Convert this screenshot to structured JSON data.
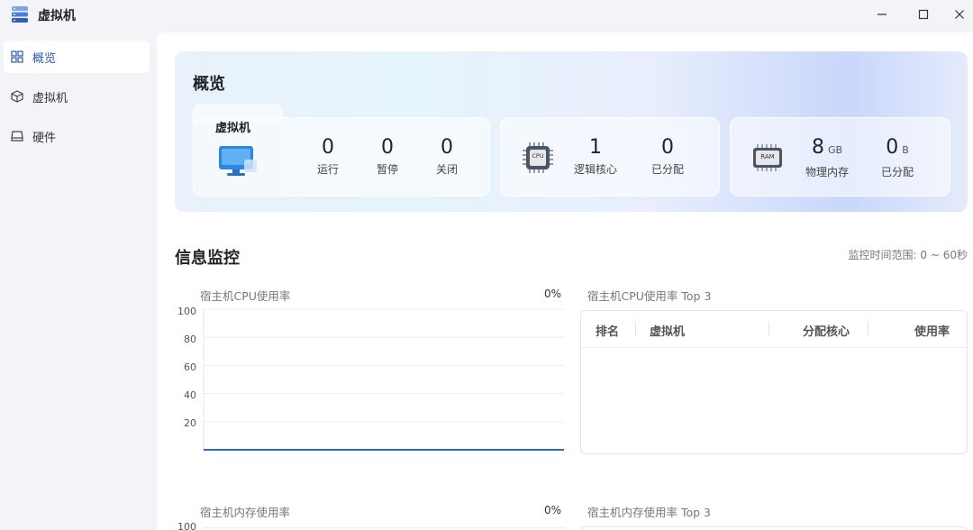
{
  "app": {
    "title": "虚拟机"
  },
  "sidebar": {
    "items": [
      {
        "label": "概览",
        "icon": "grid-icon",
        "active": true
      },
      {
        "label": "虚拟机",
        "icon": "cube-icon",
        "active": false
      },
      {
        "label": "硬件",
        "icon": "drive-icon",
        "active": false
      }
    ]
  },
  "overview": {
    "title": "概览",
    "vm_card": {
      "label": "虚拟机",
      "stats": [
        {
          "value": "0",
          "label": "运行"
        },
        {
          "value": "0",
          "label": "暂停"
        },
        {
          "value": "0",
          "label": "关闭"
        }
      ]
    },
    "cpu_card": {
      "chip_text": "CPU",
      "stats": [
        {
          "value": "1",
          "label": "逻辑核心"
        },
        {
          "value": "0",
          "label": "已分配"
        }
      ]
    },
    "ram_card": {
      "chip_text": "RAM",
      "stats": [
        {
          "value": "8",
          "unit": "GB",
          "label": "物理内存"
        },
        {
          "value": "0",
          "unit": "B",
          "label": "已分配"
        }
      ]
    }
  },
  "monitor": {
    "title": "信息监控",
    "range": "监控时间范围: 0 ~ 60秒",
    "cpu_chart": {
      "title": "宿主机CPU使用率",
      "current": "0%",
      "y_ticks": [
        "100",
        "80",
        "60",
        "40",
        "20"
      ]
    },
    "cpu_top": {
      "title": "宿主机CPU使用率 Top 3",
      "columns": [
        "排名",
        "虚拟机",
        "分配核心",
        "使用率"
      ]
    },
    "mem_chart": {
      "title": "宿主机内存使用率",
      "current": "0%",
      "y_ticks": [
        "100"
      ]
    },
    "mem_top": {
      "title": "宿主机内存使用率 Top 3"
    }
  },
  "chart_data": {
    "type": "line",
    "title": "宿主机CPU使用率",
    "ylim": [
      0,
      100
    ],
    "series": [
      {
        "values": [
          0,
          0
        ]
      }
    ],
    "grid": true
  },
  "colors": {
    "accent": "#2a5ea8",
    "line": "#2f6cb3"
  }
}
